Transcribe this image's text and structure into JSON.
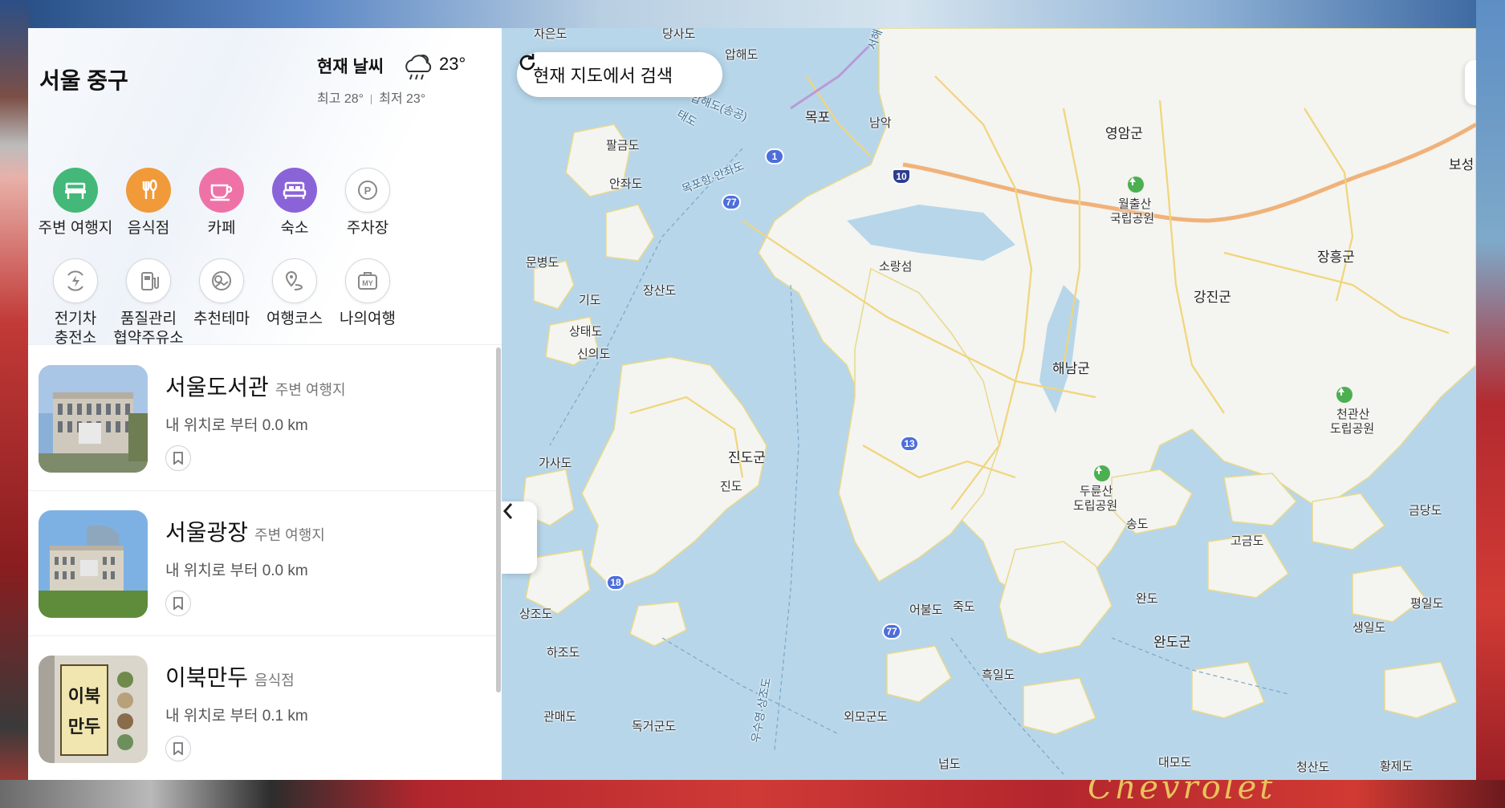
{
  "location": {
    "name": "서울 중구"
  },
  "weather": {
    "label": "현재 날씨",
    "temp": "23°",
    "high": "최고 28°",
    "low": "최저 23°"
  },
  "categories": [
    {
      "label": "주변 여행지",
      "icon": "bench-icon",
      "color": "#43b878"
    },
    {
      "label": "음식점",
      "icon": "fork-spoon-icon",
      "color": "#f09a3a"
    },
    {
      "label": "카페",
      "icon": "coffee-cup-icon",
      "color": "#ef72a7"
    },
    {
      "label": "숙소",
      "icon": "bed-icon",
      "color": "#8b63d9"
    },
    {
      "label": "주차장",
      "icon": "parking-icon"
    },
    {
      "label_line1": "전기차",
      "label_line2": "충전소",
      "icon": "ev-charging-icon"
    },
    {
      "label_line1": "품질관리",
      "label_line2": "협약주유소",
      "icon": "fuel-pump-icon"
    },
    {
      "label": "추천테마",
      "icon": "theme-icon"
    },
    {
      "label": "여행코스",
      "icon": "route-icon"
    },
    {
      "label": "나의여행",
      "icon": "my-trip-icon",
      "badge": "MY"
    }
  ],
  "places": [
    {
      "name": "서울도서관",
      "category": "주변 여행지",
      "distance": "내 위치로 부터 0.0 km"
    },
    {
      "name": "서울광장",
      "category": "주변 여행지",
      "distance": "내 위치로 부터 0.0 km"
    },
    {
      "name": "이북만두",
      "category": "음식점",
      "distance": "내 위치로 부터 0.1 km"
    }
  ],
  "map": {
    "search_button": "현재 지도에서 검색",
    "labels": {
      "mokpo": "목포",
      "namak": "남악",
      "yeongam": "영암군",
      "boseong": "보성",
      "wolchulsan": "월출산",
      "wolchulsan2": "국립공원",
      "jangheung": "장흥군",
      "gangjin": "강진군",
      "haenam": "해남군",
      "cheongwansan": "천관산",
      "cheongwansan2": "도립공원",
      "jindo_gun": "진도군",
      "jindo": "진도",
      "duryunsan": "두륜산",
      "duryunsan2": "도립공원",
      "songdo": "송도",
      "goheumdo": "고금도",
      "geumdangdo": "금당도",
      "pyeongildo": "평일도",
      "saengildo": "생일도",
      "wando": "완도",
      "wando_gun": "완도군",
      "eobuldo": "어불도",
      "jukdo": "죽도",
      "heukildo": "흑일도",
      "palgeumdo": "팔금도",
      "anjwado": "안좌도",
      "apdo": "압해도",
      "sogangseom": "소랑섬",
      "munbyeongdo": "문병도",
      "gido": "기도",
      "jangsando": "장산도",
      "sangtaedo": "상태도",
      "sinuido": "신의도",
      "gasado": "가사도",
      "sangjodo": "상조도",
      "hajodo": "하조도",
      "gwanmaedo": "관매도",
      "dokgeodo": "독거군도",
      "oemodo": "외모군도",
      "neopdo": "넙도",
      "daemodo": "대모도",
      "cheongsando": "청산도",
      "hwangjedo": "황제도",
      "jaeundo": "자은도",
      "dangsado": "당사도",
      "apdo_bridge": "압해도(송공)",
      "mokpo_route": "목포항·안좌도",
      "taedo": "태도",
      "seohae": "서해",
      "usuyeong": "우수영·상조도"
    },
    "route_shields": [
      "1",
      "10",
      "77",
      "13",
      "18",
      "77"
    ]
  }
}
